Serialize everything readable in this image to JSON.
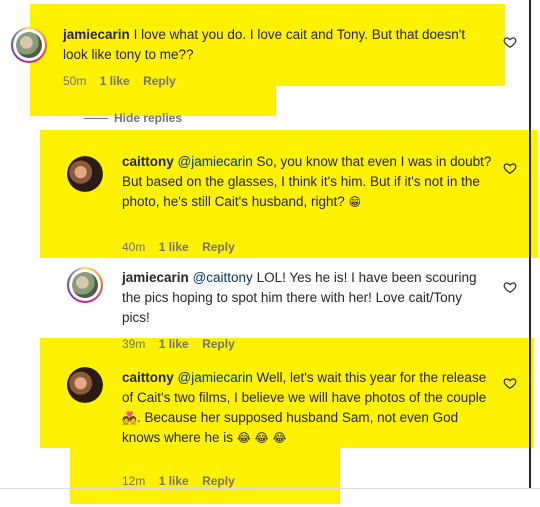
{
  "comments": [
    {
      "username": "jamiecarin",
      "text": "I love what you do. I love cait and Tony. But that doesn't look like tony to me??",
      "meta": {
        "time": "50m",
        "likes": "1 like",
        "reply": "Reply"
      }
    },
    {
      "username": "caittony",
      "mention": "@jamiecarin",
      "text": "So, you know that even I was in doubt? But based on the glasses, I think it's him. But if it's not in the photo, he's still Cait's husband, right?",
      "emoji": "😁",
      "meta": {
        "time": "40m",
        "likes": "1 like",
        "reply": "Reply"
      }
    },
    {
      "username": "jamiecarin",
      "mention": "@caittony",
      "text": "LOL! Yes he is! I have been scouring the pics hoping to spot him there with her! Love cait/Tony pics!",
      "meta": {
        "time": "39m",
        "likes": "1 like",
        "reply": "Reply"
      }
    },
    {
      "username": "caittony",
      "mention": "@jamiecarin",
      "text1": "Well, let's wait this year for the release of Cait's two films, I believe we will have photos of the couple",
      "emoji1": "💑",
      "text2": ". Because her supposed husband Sam, not even God knows where he is",
      "emoji2": "😂 😂 😂",
      "meta": {
        "time": "12m",
        "likes": "1 like",
        "reply": "Reply"
      }
    }
  ],
  "hide_replies": "Hide replies",
  "colors": {
    "highlight": "#fff200",
    "mention": "#00376b",
    "meta": "#737373"
  },
  "icons": {
    "like": "heart-outline-icon"
  }
}
